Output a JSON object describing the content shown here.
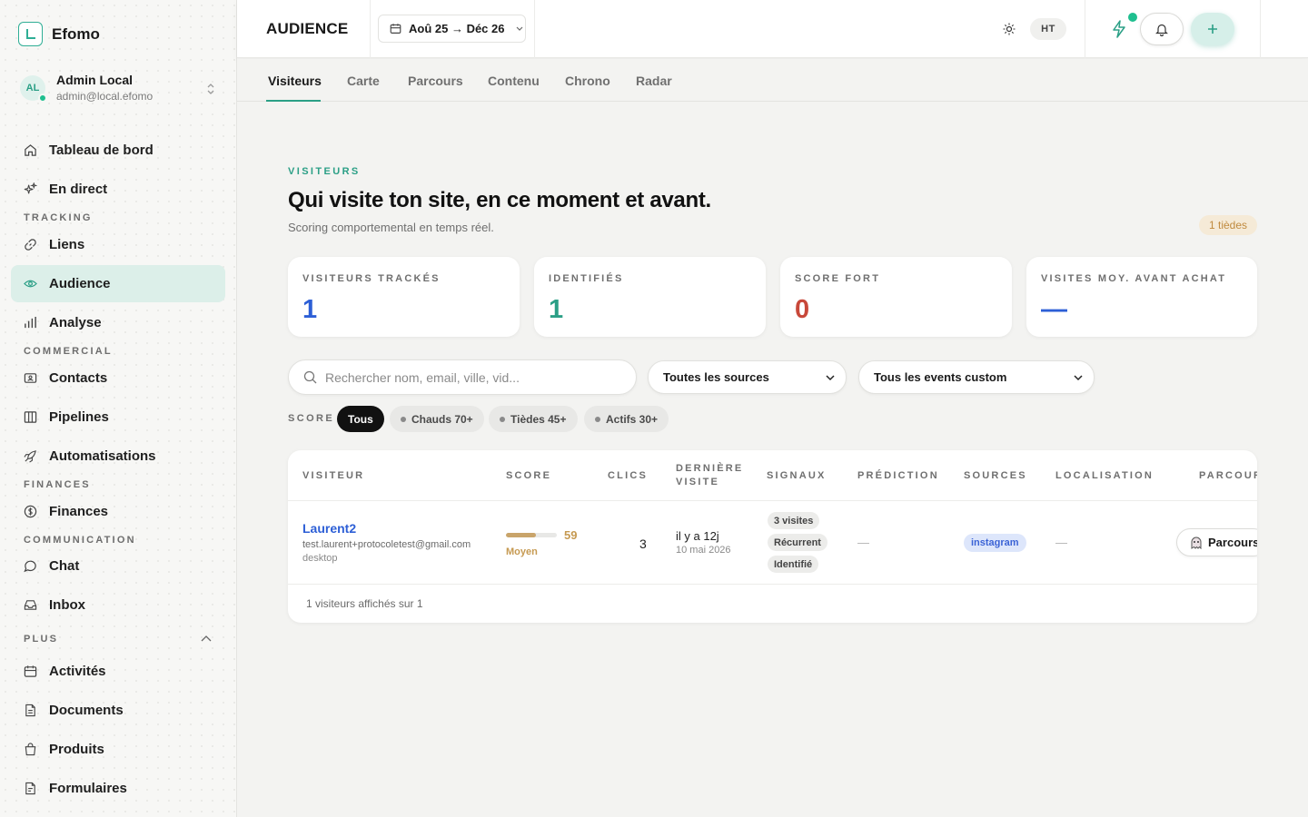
{
  "brand": {
    "name": "Efomo"
  },
  "user": {
    "initials": "AL",
    "name": "Admin Local",
    "email": "admin@local.efomo"
  },
  "sidebar": {
    "items": [
      {
        "label": "Tableau de bord",
        "icon": "home-icon"
      },
      {
        "label": "En direct",
        "icon": "sparkles-icon"
      },
      {
        "label": "Liens",
        "icon": "link-icon"
      },
      {
        "label": "Audience",
        "icon": "eye-icon",
        "active": true
      },
      {
        "label": "Analyse",
        "icon": "bar-chart-icon"
      },
      {
        "label": "Contacts",
        "icon": "contact-card-icon"
      },
      {
        "label": "Pipelines",
        "icon": "columns-icon"
      },
      {
        "label": "Automatisations",
        "icon": "rocket-icon"
      },
      {
        "label": "Finances",
        "icon": "dollar-circle-icon"
      },
      {
        "label": "Chat",
        "icon": "chat-bubble-icon"
      },
      {
        "label": "Inbox",
        "icon": "inbox-icon"
      },
      {
        "label": "Activités",
        "icon": "calendar-icon"
      },
      {
        "label": "Documents",
        "icon": "document-icon"
      },
      {
        "label": "Produits",
        "icon": "shopping-bag-icon"
      },
      {
        "label": "Formulaires",
        "icon": "form-icon"
      }
    ],
    "sections": [
      "TRACKING",
      "COMMERCIAL",
      "FINANCES",
      "COMMUNICATION",
      "PLUS"
    ]
  },
  "topbar": {
    "title": "AUDIENCE",
    "date_range": "Aoû 25 → Déc 26",
    "lang": "HT"
  },
  "tabs": [
    "Visiteurs",
    "Carte",
    "Parcours",
    "Contenu",
    "Chrono",
    "Radar"
  ],
  "header": {
    "eyebrow": "VISITEURS",
    "title": "Qui visite ton site, en ce moment et avant.",
    "subtitle": "Scoring comportemental en temps réel.",
    "badge": "1 tièdes"
  },
  "kpis": [
    {
      "label": "VISITEURS TRACKÉS",
      "value": "1",
      "color": "#2d5fd6"
    },
    {
      "label": "IDENTIFIÉS",
      "value": "1",
      "color": "#2b9f86"
    },
    {
      "label": "SCORE FORT",
      "value": "0",
      "color": "#c8483a"
    },
    {
      "label": "VISITES MOY. AVANT ACHAT",
      "value": "—",
      "color": "#2d5fd6"
    }
  ],
  "filters": {
    "search_placeholder": "Rechercher nom, email, ville, vid...",
    "sources": "Toutes les sources",
    "events": "Tous les events custom",
    "score_label": "SCORE",
    "chips": [
      "Tous",
      "Chauds 70+",
      "Tièdes 45+",
      "Actifs 30+"
    ]
  },
  "table": {
    "columns": [
      "VISITEUR",
      "SCORE",
      "CLICS",
      "DERNIÈRE\nVISITE",
      "SIGNAUX",
      "PRÉDICTION",
      "SOURCES",
      "LOCALISATION",
      "PARCOURS"
    ],
    "rows": [
      {
        "name": "Laurent2",
        "email": "test.laurent+protocoletest@gmail.com",
        "device": "desktop",
        "score": 59,
        "score_fraction": 0.59,
        "score_tier": "Moyen",
        "clics": "3",
        "last_relative": "il y a 12j",
        "last_date": "10 mai 2026",
        "signals": [
          "3 visites",
          "Récurrent",
          "Identifié"
        ],
        "prediction": "—",
        "source": "instagram",
        "location": "—",
        "parcours_label": "Parcours"
      }
    ],
    "footer": "1 visiteurs affichés sur 1"
  }
}
